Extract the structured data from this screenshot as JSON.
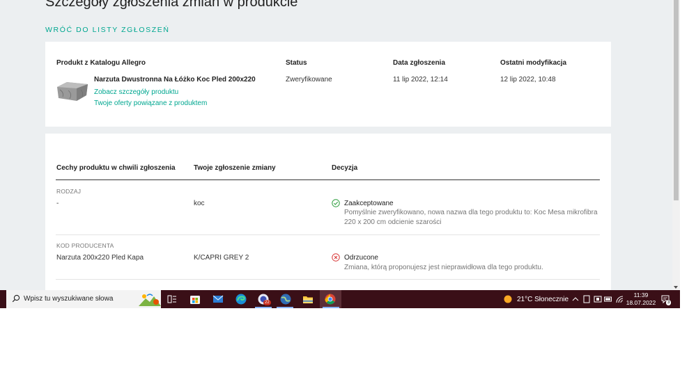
{
  "page": {
    "title": "Szczegóły zgłoszenia zmian w produkcie",
    "back_link": "WRÓĆ DO LISTY ZGŁOSZEŃ"
  },
  "summary": {
    "headers": {
      "product": "Produkt z Katalogu Allegro",
      "status": "Status",
      "created": "Data zgłoszenia",
      "modified": "Ostatni modyfikacja"
    },
    "product_name": "Narzuta Dwustronna Na Łóżko Koc Pled 200x220",
    "product_details_link": "Zobacz szczegóły produktu",
    "offers_link": "Twoje oferty powiązane z produktem",
    "status": "Zweryfikowane",
    "created": "11 lip 2022, 12:14",
    "modified": "12 lip 2022, 10:48"
  },
  "changes": {
    "headers": {
      "current": "Cechy produktu w chwili zgłoszenia",
      "proposed": "Twoje zgłoszenie zmiany",
      "decision": "Decyzja"
    },
    "rows": [
      {
        "attribute": "RODZAJ",
        "current": "-",
        "proposed": "koc",
        "decision": "Zaakceptowane",
        "decision_type": "accepted",
        "description": "Pomyślnie zweryfikowano, nowa nazwa dla tego produktu to: Koc Mesa mikrofibra 220 x 200 cm odcienie szarości"
      },
      {
        "attribute": "KOD PRODUCENTA",
        "current": "Narzuta 200x220 Pled Kapa",
        "proposed": "K/CAPRI GREY 2",
        "decision": "Odrzucone",
        "decision_type": "rejected",
        "description": "Zmiana, którą proponujesz jest nieprawidłowa dla tego produktu."
      }
    ]
  },
  "colors": {
    "accent": "#00a790",
    "accepted": "#2e9e3e",
    "rejected": "#d93a3a",
    "taskbar": "#3a0f17"
  },
  "taskbar": {
    "search_placeholder": "Wpisz tu wyszukiwane słowa",
    "apps": [
      "task-view-icon",
      "store-icon",
      "mail-icon",
      "edge-icon",
      "chat-icon",
      "globe-icon",
      "file-explorer-icon",
      "chrome-icon"
    ],
    "chat_badge": "22",
    "weather": "21°C  Słonecznie",
    "time": "11:39",
    "date": "18.07.2022",
    "notification_count": "3"
  }
}
